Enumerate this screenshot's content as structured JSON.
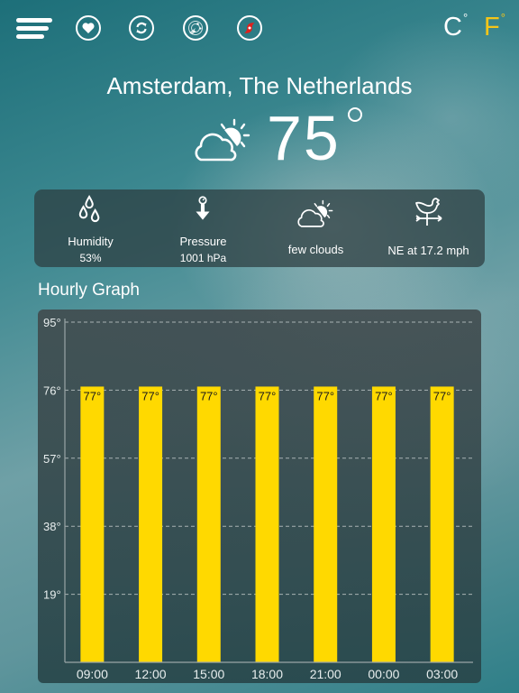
{
  "toolbar": {
    "menu_icon": "hamburger-menu-icon",
    "buttons": [
      {
        "name": "favorites",
        "icon": "heart-icon"
      },
      {
        "name": "refresh",
        "icon": "refresh-icon"
      },
      {
        "name": "radar",
        "icon": "radar-icon"
      },
      {
        "name": "hurricane",
        "icon": "hurricane-icon",
        "color": "#e0201c"
      }
    ],
    "units": {
      "celsius": "C",
      "fahrenheit": "F",
      "active": "F",
      "active_color": "#f5c518",
      "inactive_color": "#ffffff",
      "degree_symbol": "°"
    }
  },
  "location": "Amsterdam, The Netherlands",
  "current": {
    "temperature": "75",
    "icon": "partly-cloudy-icon"
  },
  "details": [
    {
      "icon": "humidity-drops-icon",
      "label": "Humidity",
      "value": "53%"
    },
    {
      "icon": "barometer-arrow-icon",
      "label": "Pressure",
      "value": "1001 hPa"
    },
    {
      "icon": "partly-cloudy-icon",
      "label": "few clouds",
      "value": ""
    },
    {
      "icon": "weather-vane-rooster-icon",
      "label": "NE at 17.2 mph",
      "value": ""
    }
  ],
  "graph_title": "Hourly Graph",
  "chart_data": {
    "type": "bar",
    "title": "Hourly Graph",
    "categories": [
      "09:00",
      "12:00",
      "15:00",
      "18:00",
      "21:00",
      "00:00",
      "03:00"
    ],
    "values": [
      77,
      77,
      77,
      77,
      77,
      77,
      77
    ],
    "value_labels": [
      "77°",
      "77°",
      "77°",
      "77°",
      "77°",
      "77°",
      "77°"
    ],
    "yticks": [
      19,
      38,
      57,
      76,
      95
    ],
    "ytick_labels": [
      "19°",
      "38°",
      "57°",
      "76°",
      "95°"
    ],
    "ylim": [
      0,
      95
    ],
    "xlabel": "",
    "ylabel": "",
    "grid": true,
    "bar_color": "#ffd900",
    "label_color": "#1a1a1a"
  }
}
